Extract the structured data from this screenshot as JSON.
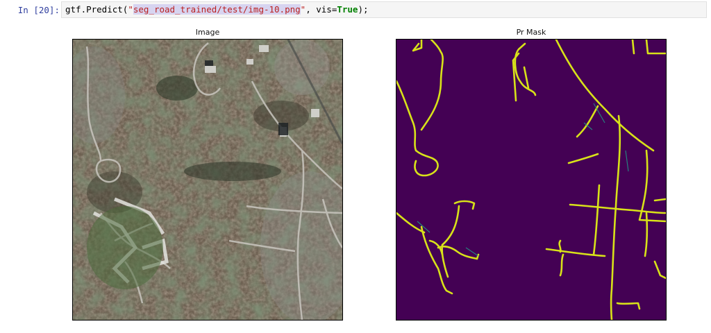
{
  "cell": {
    "prompt": "In [20]:",
    "code": {
      "fn": "gtf.Predict(",
      "quote_open": "\"",
      "path": "seg_road_trained/test/img-10.png",
      "quote_close": "\"",
      "mid": ", vis=",
      "kw": "True",
      "end": ");"
    }
  },
  "output": {
    "left_title": "Image",
    "right_title": "Pr Mask",
    "mask_colors": {
      "background": "#440154",
      "road": "#d8e219"
    },
    "image_description": "aerial-satellite-image"
  }
}
